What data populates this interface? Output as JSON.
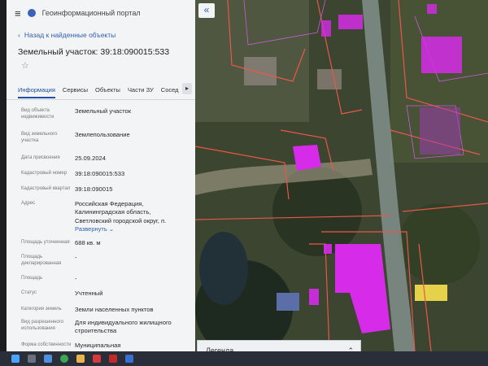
{
  "app": {
    "title": "Геоинформационный портал"
  },
  "panel": {
    "back_link": "Назад к найденные объекты",
    "object_title": "Земельный участок: 39:18:090015:533",
    "star": "☆",
    "tabs": [
      "Информация",
      "Сервисы",
      "Объекты",
      "Части ЗУ",
      "Сосед"
    ],
    "tab_arrow": "▸",
    "attributes": [
      {
        "label": "Вид объекта недвижимости",
        "value": "Земельный участок"
      },
      {
        "label": "Вид земельного участка",
        "value": "Землепользование"
      },
      {
        "label": "Дата присвоения",
        "value": "25.09.2024"
      },
      {
        "label": "Кадастровый номер",
        "value": "39:18:090015:533"
      },
      {
        "label": "Кадастровый квартал",
        "value": "39:18:090015"
      },
      {
        "label": "Адрес",
        "value": "Российская Федерация, Калининградская область, Светловский городской округ, п."
      },
      {
        "label": "Площадь уточненная",
        "value": "688 кв. м"
      },
      {
        "label": "Площадь декларированная",
        "value": "-"
      },
      {
        "label": "Площадь",
        "value": "-"
      },
      {
        "label": "Статус",
        "value": "Учтенный"
      },
      {
        "label": "Категория земель",
        "value": "Земли населенных пунктов"
      },
      {
        "label": "Вид разрешенного использования",
        "value": "Для индивидуального жилищного строительства"
      },
      {
        "label": "Форма собственности",
        "value": "Муниципальная"
      }
    ],
    "expand_label": "Развернуть ⌄"
  },
  "map": {
    "collapse_icon": "«",
    "legend": {
      "label": "Легенда",
      "chevron": "⌃"
    }
  },
  "colors": {
    "parcel_highlight": "#d62be8",
    "boundary": "#e8574a",
    "accent": "#2f5fb0"
  }
}
